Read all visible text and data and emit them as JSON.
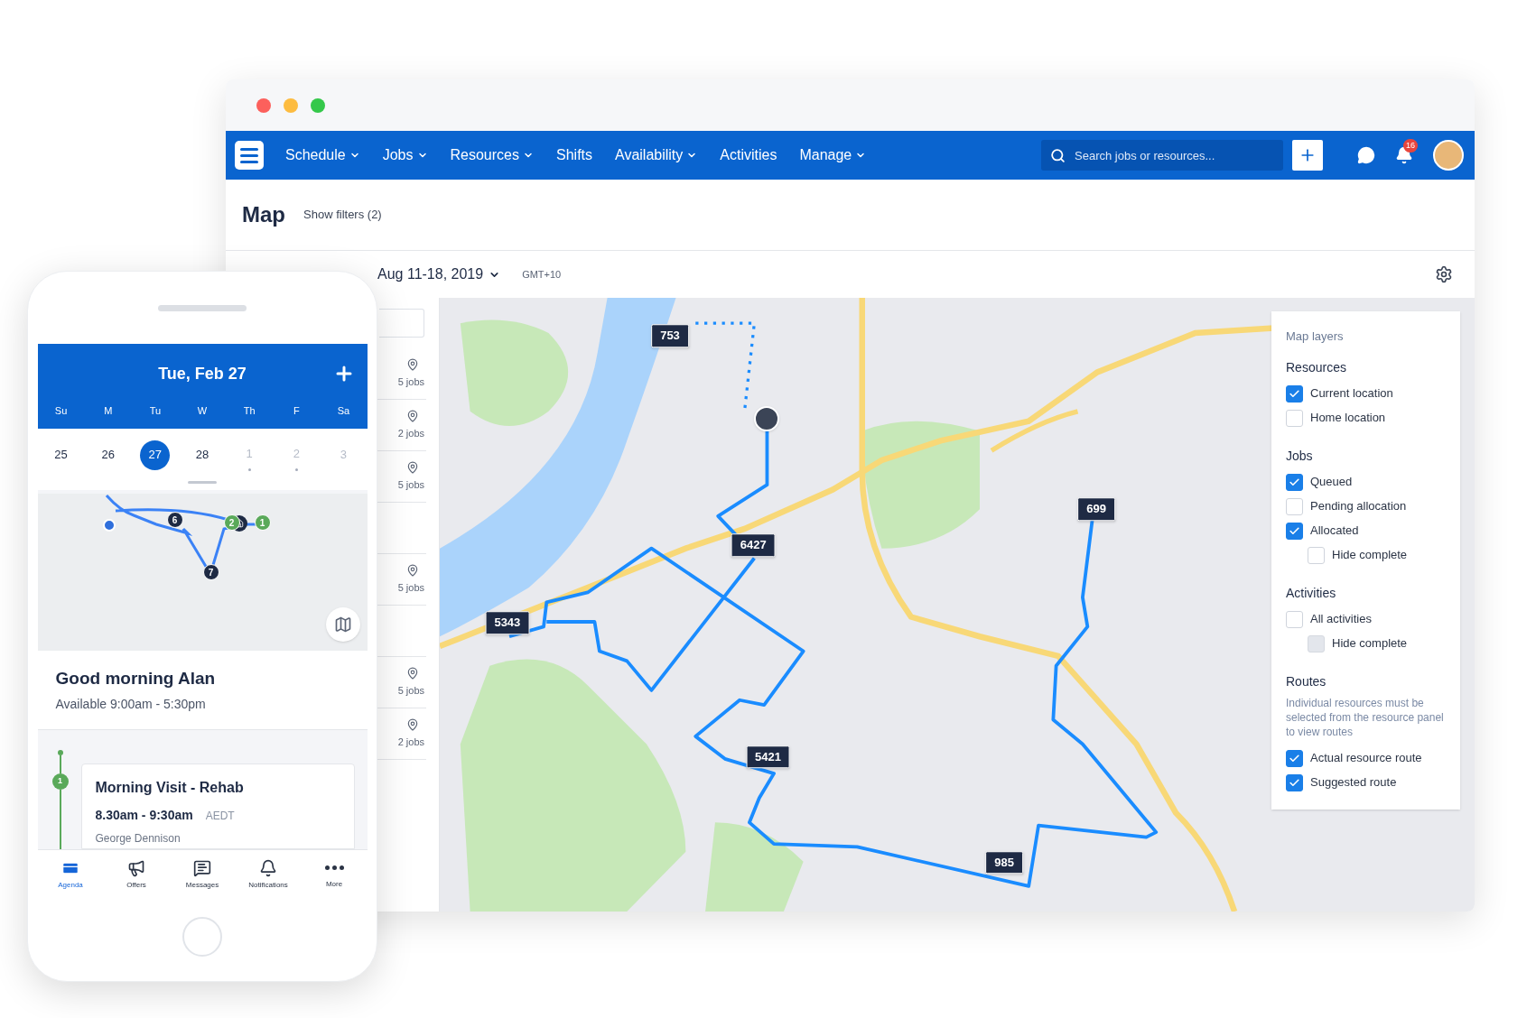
{
  "browser": {
    "nav": {
      "items": [
        {
          "label": "Schedule",
          "dropdown": true
        },
        {
          "label": "Jobs",
          "dropdown": true
        },
        {
          "label": "Resources",
          "dropdown": true
        },
        {
          "label": "Shifts",
          "dropdown": false
        },
        {
          "label": "Availability",
          "dropdown": true
        },
        {
          "label": "Activities",
          "dropdown": false
        },
        {
          "label": "Manage",
          "dropdown": true
        }
      ],
      "search": {
        "placeholder": "Search jobs or resources..."
      },
      "notifications": "16"
    },
    "header": {
      "title": "Map",
      "filters_link": "Show filters (2)"
    },
    "toolbar": {
      "date_range": "Aug 11-18, 2019",
      "timezone": "GMT+10"
    },
    "resource_list": [
      {
        "kind": "count",
        "jobs": "5 jobs"
      },
      {
        "kind": "count",
        "jobs": "2 jobs"
      },
      {
        "kind": "count",
        "jobs": "5 jobs"
      },
      {
        "kind": "blank"
      },
      {
        "kind": "count",
        "jobs": "5 jobs"
      },
      {
        "kind": "blank"
      },
      {
        "kind": "count",
        "jobs": "5 jobs"
      },
      {
        "kind": "count",
        "jobs": "2 jobs"
      }
    ],
    "map": {
      "job_markers": [
        "753",
        "6427",
        "5343",
        "5421",
        "699",
        "985"
      ]
    },
    "map_layers": {
      "title": "Map layers",
      "sections": [
        {
          "heading": "Resources",
          "items": [
            {
              "label": "Current location",
              "checked": true,
              "disabled": false
            },
            {
              "label": "Home location",
              "checked": false,
              "disabled": false
            }
          ]
        },
        {
          "heading": "Jobs",
          "items": [
            {
              "label": "Queued",
              "checked": true,
              "disabled": false
            },
            {
              "label": "Pending allocation",
              "checked": false,
              "disabled": false
            },
            {
              "label": "Allocated",
              "checked": true,
              "disabled": false,
              "children": [
                {
                  "label": "Hide complete",
                  "checked": false,
                  "disabled": false
                }
              ]
            }
          ]
        },
        {
          "heading": "Activities",
          "items": [
            {
              "label": "All activities",
              "checked": false,
              "disabled": false,
              "children": [
                {
                  "label": "Hide complete",
                  "checked": false,
                  "disabled": true
                }
              ]
            }
          ]
        },
        {
          "heading": "Routes",
          "note": "Individual resources must be selected from the resource panel to view routes",
          "items": [
            {
              "label": "Actual resource route",
              "checked": true,
              "disabled": false
            },
            {
              "label": "Suggested route",
              "checked": true,
              "disabled": false
            }
          ]
        }
      ]
    }
  },
  "phone": {
    "date_title": "Tue, Feb 27",
    "weekdays": [
      "Su",
      "M",
      "Tu",
      "W",
      "Th",
      "F",
      "Sa"
    ],
    "dates": [
      {
        "day": "25",
        "selected": false,
        "has_events": false,
        "dimmed": false
      },
      {
        "day": "26",
        "selected": false,
        "has_events": false,
        "dimmed": false
      },
      {
        "day": "27",
        "selected": true,
        "has_events": false,
        "dimmed": false
      },
      {
        "day": "28",
        "selected": false,
        "has_events": false,
        "dimmed": false
      },
      {
        "day": "1",
        "selected": false,
        "has_events": true,
        "dimmed": true
      },
      {
        "day": "2",
        "selected": false,
        "has_events": true,
        "dimmed": true
      },
      {
        "day": "3",
        "selected": false,
        "has_events": false,
        "dimmed": true
      }
    ],
    "map_stops": [
      {
        "label": "6",
        "color": "#1e2a44"
      },
      {
        "label": "2",
        "color": "#5aa95a"
      },
      {
        "label": "1",
        "color": "#5aa95a"
      },
      {
        "label": "7",
        "color": "#1e2a44"
      }
    ],
    "greeting": "Good morning Alan",
    "availability": "Available 9:00am - 5:30pm",
    "visit": {
      "step": "1",
      "title": "Morning Visit - Rehab",
      "time": "8.30am - 9:30am",
      "timezone": "AEDT",
      "client": "George Dennison"
    },
    "tabs": [
      {
        "label": "Agenda",
        "selected": true
      },
      {
        "label": "Offers",
        "selected": false
      },
      {
        "label": "Messages",
        "selected": false
      },
      {
        "label": "Notifications",
        "selected": false
      },
      {
        "label": "More",
        "selected": false
      }
    ]
  }
}
